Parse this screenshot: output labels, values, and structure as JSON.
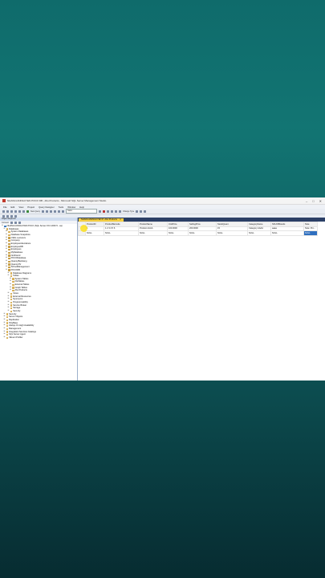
{
  "window": {
    "title": "NHANLUANNGUYEN POCO DB - dbo.Products - Microsoft SQL Server Management Studio",
    "controls": [
      "–",
      "□",
      "✕"
    ]
  },
  "menu": [
    "File",
    "Edit",
    "View",
    "Project",
    "Query Designer",
    "Tools",
    "Window",
    "Help"
  ],
  "toolbar": {
    "new_query": "New Query",
    "db_select": "Sales",
    "change_type": "Change Type"
  },
  "object_explorer": {
    "header": "Object Explorer",
    "connect": "Connect",
    "tree": [
      {
        "label": "NHANLUANNGUYEN POCO (SQL Server 15.0.2000.5 - sa)",
        "icon": "server-icon",
        "depth": 0,
        "exp": "⊟"
      },
      {
        "label": "Databases",
        "icon": "folder-icon",
        "depth": 1,
        "exp": "⊟"
      },
      {
        "label": "System Databases",
        "icon": "folder-icon",
        "depth": 2,
        "exp": "⊞"
      },
      {
        "label": "Database Snapshots",
        "icon": "folder-icon",
        "depth": 2,
        "exp": "⊞"
      },
      {
        "label": "CSDL Lecturers",
        "icon": "database-icon",
        "depth": 2,
        "exp": "⊞"
      },
      {
        "label": "Company",
        "icon": "database-icon",
        "depth": 2,
        "exp": "⊞"
      },
      {
        "label": "EmployeeAttendance",
        "icon": "database-icon",
        "depth": 2,
        "exp": "⊞"
      },
      {
        "label": "EmployeeDB",
        "icon": "database-icon",
        "depth": 2,
        "exp": "⊞"
      },
      {
        "label": "Employees",
        "icon": "database-icon",
        "depth": 2,
        "exp": "⊞"
      },
      {
        "label": "MyDatabase",
        "icon": "database-icon",
        "depth": 2,
        "exp": "⊞"
      },
      {
        "label": "Northwind",
        "icon": "database-icon",
        "depth": 2,
        "exp": "⊞"
      },
      {
        "label": "POCODatabase",
        "icon": "database-icon",
        "depth": 2,
        "exp": "⊞"
      },
      {
        "label": "QuanLyBanHang",
        "icon": "database-icon",
        "depth": 2,
        "exp": "⊞"
      },
      {
        "label": "QuanLyNV",
        "icon": "database-icon",
        "depth": 2,
        "exp": "⊞"
      },
      {
        "label": "SchoolManagement",
        "icon": "database-icon",
        "depth": 2,
        "exp": "⊞"
      },
      {
        "label": "POCODB",
        "icon": "database-icon",
        "depth": 2,
        "exp": "⊟"
      },
      {
        "label": "Database Diagrams",
        "icon": "folder-icon",
        "depth": 3,
        "exp": "⊞"
      },
      {
        "label": "Tables",
        "icon": "folder-icon",
        "depth": 3,
        "exp": "⊟"
      },
      {
        "label": "System Tables",
        "icon": "folder-icon",
        "depth": 4,
        "exp": "⊞"
      },
      {
        "label": "FileTables",
        "icon": "folder-icon",
        "depth": 4,
        "exp": "⊞"
      },
      {
        "label": "External Tables",
        "icon": "folder-icon",
        "depth": 4,
        "exp": "⊞"
      },
      {
        "label": "Graph Tables",
        "icon": "folder-icon",
        "depth": 4,
        "exp": "⊞"
      },
      {
        "label": "dbo.Products",
        "icon": "table-icon",
        "depth": 4,
        "exp": "⊞"
      },
      {
        "label": "Views",
        "icon": "folder-icon",
        "depth": 3,
        "exp": "⊞"
      },
      {
        "label": "External Resources",
        "icon": "folder-icon",
        "depth": 3,
        "exp": "⊞"
      },
      {
        "label": "Synonyms",
        "icon": "folder-icon",
        "depth": 3,
        "exp": "⊞"
      },
      {
        "label": "Programmability",
        "icon": "folder-icon",
        "depth": 3,
        "exp": "⊞"
      },
      {
        "label": "Service Broker",
        "icon": "folder-icon",
        "depth": 3,
        "exp": "⊞"
      },
      {
        "label": "Storage",
        "icon": "folder-icon",
        "depth": 3,
        "exp": "⊞"
      },
      {
        "label": "Security",
        "icon": "folder-icon",
        "depth": 3,
        "exp": "⊞"
      },
      {
        "label": "Security",
        "icon": "folder-icon",
        "depth": 1,
        "exp": "⊞"
      },
      {
        "label": "Server Objects",
        "icon": "folder-icon",
        "depth": 1,
        "exp": "⊞"
      },
      {
        "label": "Replication",
        "icon": "folder-icon",
        "depth": 1,
        "exp": "⊞"
      },
      {
        "label": "PolyBase",
        "icon": "folder-icon",
        "depth": 1,
        "exp": "⊞"
      },
      {
        "label": "Always On High Availability",
        "icon": "folder-icon",
        "depth": 1,
        "exp": "⊞"
      },
      {
        "label": "Management",
        "icon": "folder-icon",
        "depth": 1,
        "exp": "⊞"
      },
      {
        "label": "Integration Services Catalogs",
        "icon": "folder-icon",
        "depth": 1,
        "exp": "⊞"
      },
      {
        "label": "SQL Server Agent",
        "icon": "agent-icon",
        "depth": 1,
        "exp": "⊞"
      },
      {
        "label": "XEvent Profiler",
        "icon": "folder-icon",
        "depth": 1,
        "exp": "⊞"
      }
    ]
  },
  "editor": {
    "tab_label": "NHANLUANNGUYEN P...dbo.Products",
    "columns": [
      "ProductID",
      "ProductBarcode",
      "ProductName",
      "UnitPrice",
      "SellingPrice",
      "StockQuant",
      "CategoryName",
      "SKUOfBrands",
      "Note"
    ],
    "rows": [
      [
        "1",
        "1 2 3 4 5 6",
        "Product AAAA",
        "100.0000",
        "200.0000",
        "15",
        "Category AAAA",
        "aaaa",
        "Note: Pro..."
      ],
      [
        "NULL",
        "NULL",
        "NULL",
        "NULL",
        "NULL",
        "NULL",
        "NULL",
        "NULL",
        "NULL"
      ]
    ]
  }
}
